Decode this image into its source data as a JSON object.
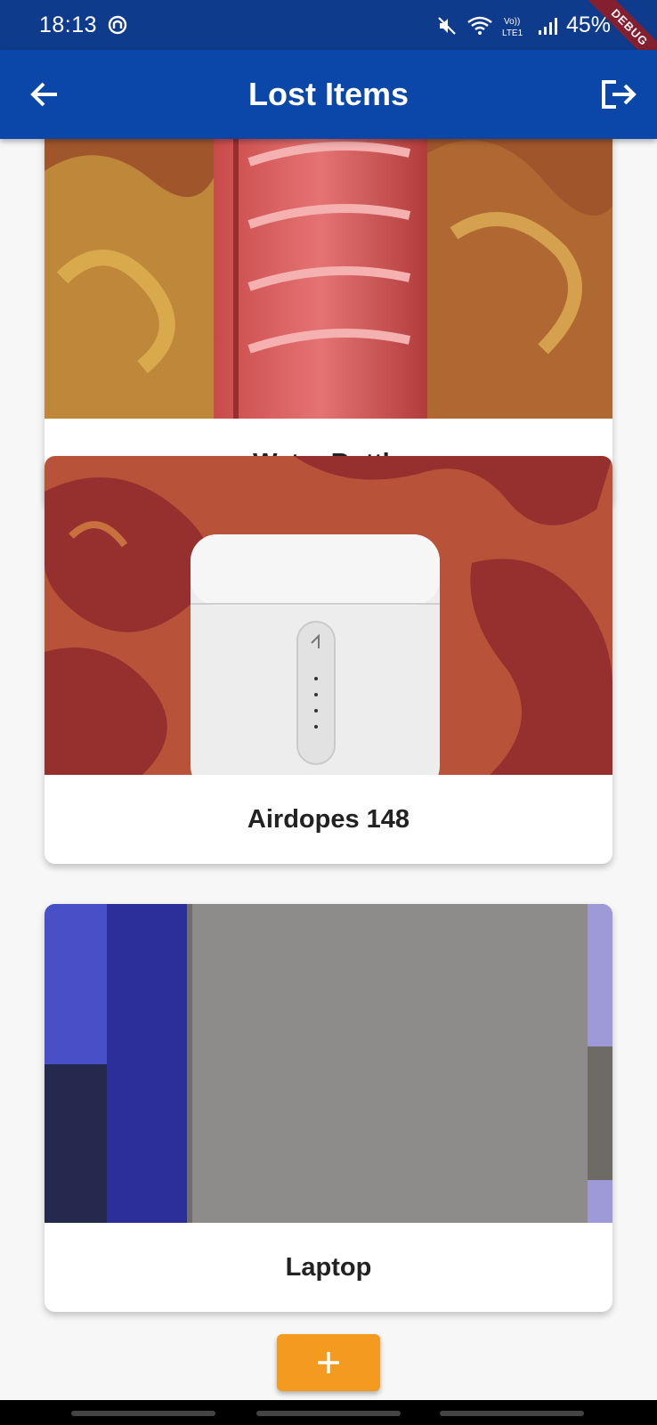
{
  "status_bar": {
    "time": "18:13",
    "battery": "45%",
    "icons": [
      "app-notification-icon",
      "mute-icon",
      "wifi-icon",
      "volte-icon",
      "signal-icon"
    ],
    "debug_label": "DEBUG"
  },
  "app_bar": {
    "title": "Lost Items",
    "back_icon": "arrow-back-icon",
    "logout_icon": "logout-icon",
    "color": "#0b47a8"
  },
  "items": [
    {
      "title": "Water Bottle"
    },
    {
      "title": "Airdopes 148"
    },
    {
      "title": "Laptop"
    }
  ],
  "fab": {
    "icon": "plus-icon",
    "color": "#f39a1f"
  }
}
